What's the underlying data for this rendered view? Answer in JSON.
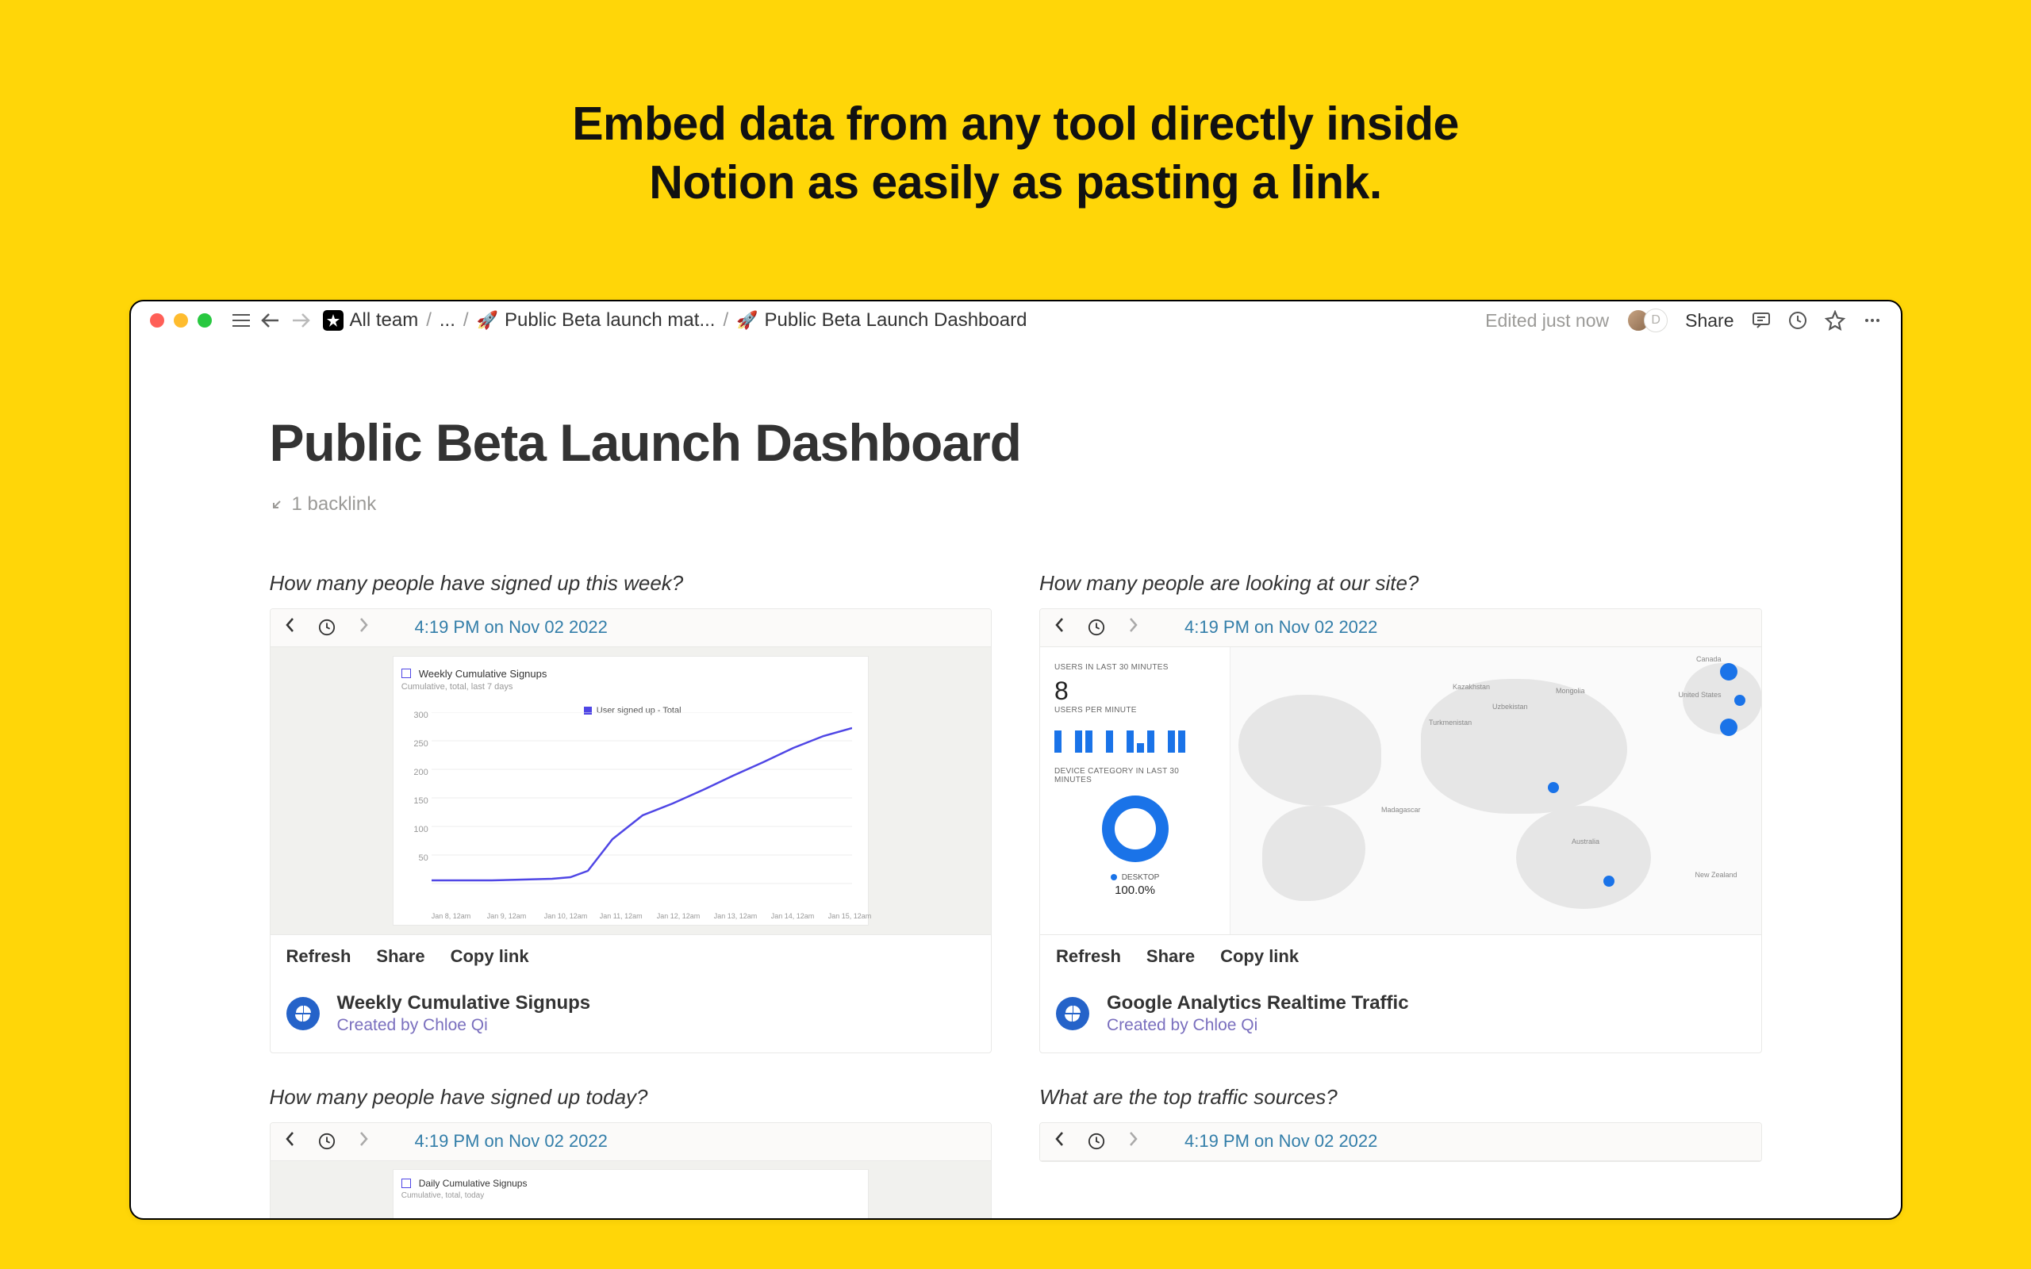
{
  "headline_1": "Embed data from any tool directly inside",
  "headline_2": "Notion as easily as pasting a link.",
  "breadcrumbs": {
    "team": "All team",
    "ellipsis": "...",
    "parent": "Public Beta launch mat...",
    "current": "Public Beta Launch Dashboard"
  },
  "titlebar": {
    "edited": "Edited just now",
    "share": "Share",
    "presence_initial": "D"
  },
  "page": {
    "title": "Public Beta Launch Dashboard",
    "backlink": "1 backlink"
  },
  "sections": {
    "s1": "How many people have signed up this week?",
    "s2": "How many people are looking at our site?",
    "s3": "How many people have signed up today?",
    "s4": "What are the top traffic sources?"
  },
  "embed_common": {
    "timestamp": "4:19 PM on Nov 02 2022",
    "actions": {
      "refresh": "Refresh",
      "share": "Share",
      "copy": "Copy link"
    }
  },
  "embeds": {
    "signups": {
      "name": "Weekly Cumulative Signups",
      "creator": "Created by Chloe Qi",
      "chart": {
        "title": "Weekly Cumulative Signups",
        "subtitle": "Cumulative, total, last 7 days",
        "legend": "User signed up - Total",
        "yticks": [
          "300",
          "250",
          "200",
          "150",
          "100",
          "50"
        ],
        "xticks": [
          "Jan 8, 12am",
          "Jan 9, 12am",
          "Jan 10, 12am",
          "Jan 11, 12am",
          "Jan 12, 12am",
          "Jan 13, 12am",
          "Jan 14, 12am",
          "Jan 15, 12am"
        ]
      }
    },
    "analytics": {
      "name": "Google Analytics Realtime Traffic",
      "creator": "Created by Chloe Qi",
      "card": {
        "h1": "USERS IN LAST 30 MINUTES",
        "big": "8",
        "h2": "USERS PER MINUTE",
        "h3": "DEVICE CATEGORY IN LAST 30 MINUTES",
        "device": "DESKTOP",
        "pct": "100.0%"
      }
    },
    "daily": {
      "chart": {
        "title": "Daily Cumulative Signups",
        "subtitle": "Cumulative, total, today"
      }
    }
  },
  "chart_data": {
    "type": "line",
    "title": "Weekly Cumulative Signups",
    "subtitle": "Cumulative, total, last 7 days",
    "legend": "User signed up - Total",
    "ylabel": "",
    "xlabel": "",
    "ylim": [
      0,
      300
    ],
    "categories": [
      "Jan 8, 12am",
      "Jan 9, 12am",
      "Jan 10, 12am",
      "Jan 11, 12am",
      "Jan 12, 12am",
      "Jan 13, 12am",
      "Jan 14, 12am",
      "Jan 15, 12am"
    ],
    "x": [
      0,
      1,
      2,
      2.3,
      2.6,
      3,
      3.5,
      4,
      4.5,
      5,
      5.5,
      6,
      6.5,
      7
    ],
    "values": [
      6,
      6,
      7,
      8,
      20,
      75,
      120,
      145,
      170,
      195,
      215,
      240,
      260,
      275
    ]
  }
}
